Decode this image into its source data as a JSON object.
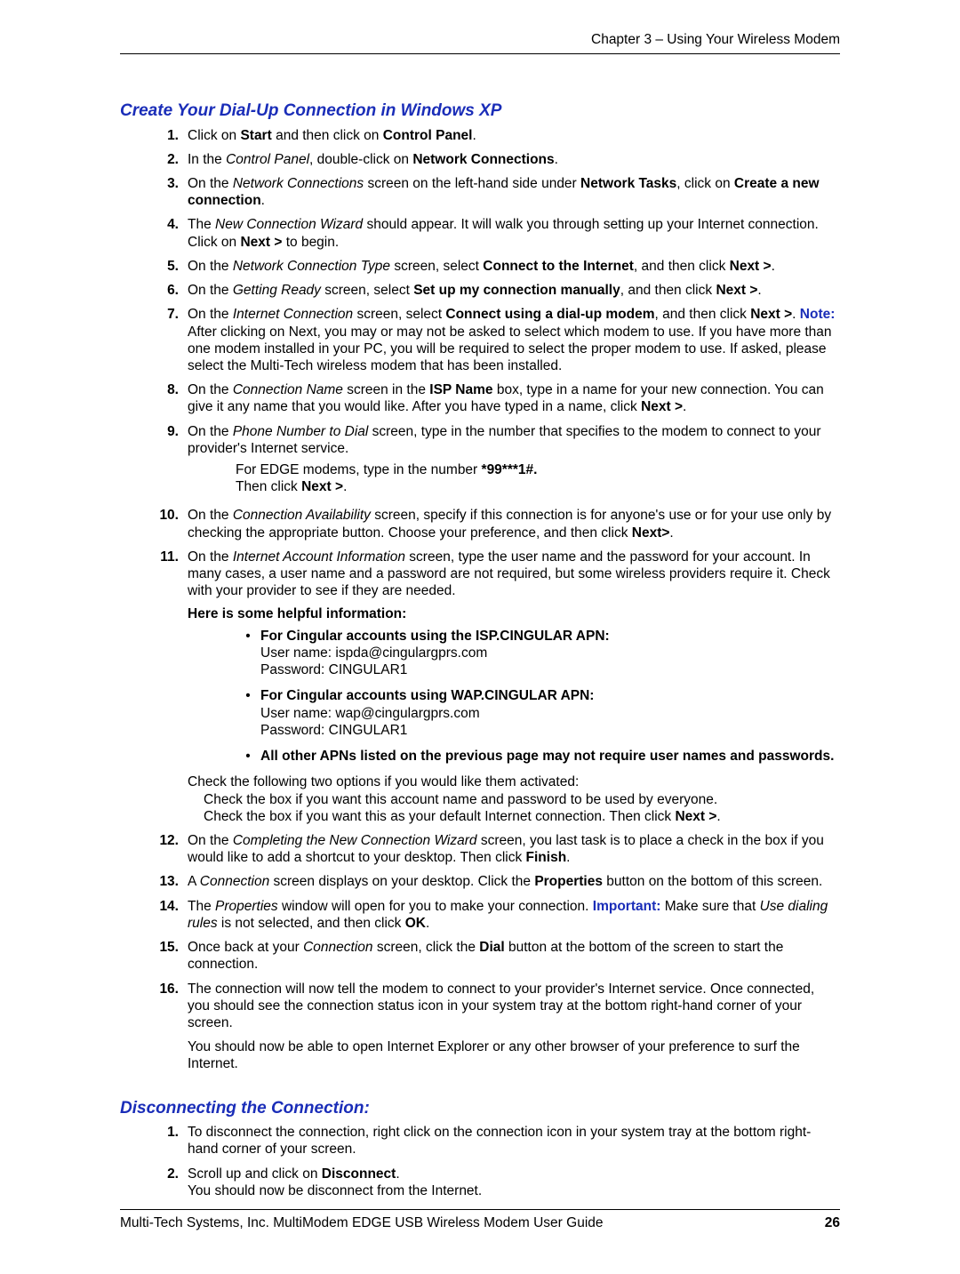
{
  "header": "Chapter 3 – Using Your Wireless Modem",
  "footer_left": "Multi-Tech Systems, Inc. MultiModem EDGE USB Wireless Modem User Guide",
  "footer_right": "26",
  "h1": "Create Your Dial-Up Connection in Windows XP",
  "h2": "Disconnecting the Connection:",
  "s1": {
    "n": "1.",
    "a": "Click on ",
    "b": "Start",
    "c": " and then click on ",
    "d": "Control Panel",
    "e": "."
  },
  "s2": {
    "n": "2.",
    "a": "In the ",
    "b": "Control Panel",
    "c": ", double-click on ",
    "d": "Network Connections",
    "e": "."
  },
  "s3": {
    "n": "3.",
    "a": "On the ",
    "b": "Network Connections",
    "c": " screen on the left-hand side under ",
    "d": "Network Tasks",
    "e": ", click on ",
    "f": "Create a new connection",
    "g": "."
  },
  "s4": {
    "n": "4.",
    "a": "The ",
    "b": "New Connection Wizard",
    "c": " should appear. It will walk you through setting up your Internet connection. Click on ",
    "d": "Next >",
    "e": " to begin."
  },
  "s5": {
    "n": "5.",
    "a": "On the ",
    "b": "Network Connection Type",
    "c": " screen, select ",
    "d": "Connect to the Internet",
    "e": ", and then click ",
    "f": "Next >",
    "g": "."
  },
  "s6": {
    "n": "6.",
    "a": "On the ",
    "b": "Getting Ready",
    "c": " screen, select ",
    "d": "Set up my connection manually",
    "e": ", and then click ",
    "f": "Next >",
    "g": "."
  },
  "s7": {
    "n": "7.",
    "a": "On the ",
    "b": "Internet Connection",
    "c": " screen, select ",
    "d": "Connect using a dial-up modem",
    "e": ", and then click ",
    "f": "Next >",
    "g": ". ",
    "note": "Note:",
    "h": " After clicking on Next, you may or may not be asked to select which modem to use. If you have more than one modem installed in your PC, you will be required to select the proper modem to use. If asked, please select the Multi-Tech wireless modem that has been installed."
  },
  "s8": {
    "n": "8.",
    "a": "On the ",
    "b": "Connection Name",
    "c": " screen in the ",
    "d": "ISP Name",
    "e": " box, type in a name for your new connection. You can give it any name that you would like. After you have typed in a name, click ",
    "f": "Next >",
    "g": "."
  },
  "s9": {
    "n": "9.",
    "a": "On the ",
    "b": "Phone Number to Dial",
    "c": " screen, type in the number that specifies to the modem to connect to your provider's Internet service.",
    "line1a": "For EDGE modems, type in the number ",
    "line1b": "*99***1#.",
    "line2a": "Then click ",
    "line2b": "Next >",
    "line2c": "."
  },
  "s10": {
    "n": "10.",
    "a": "On the ",
    "b": "Connection Availability",
    "c": " screen, specify if this connection is for anyone's use or for your use only by checking the appropriate button. Choose your preference, and then click ",
    "d": "Next>",
    "e": "."
  },
  "s11": {
    "n": "11.",
    "a": "On the ",
    "b": "Internet Account Information",
    "c": " screen, type the user name and the password for your account. In many cases, a user name and a password are not required, but some wireless providers require it. Check with your provider to see if they are needed.",
    "helpful": "Here is some helpful information:",
    "bul1_h": "For Cingular accounts using the ISP.CINGULAR APN:",
    "bul1_u": "User name: ispda@cingulargprs.com",
    "bul1_p": "Password: CINGULAR1",
    "bul2_h": "For Cingular accounts using WAP.CINGULAR APN:",
    "bul2_u": "User name: wap@cingulargprs.com",
    "bul2_p": "Password: CINGULAR1",
    "bul3": "All other APNs listed on the previous page may not require user names and passwords.",
    "check_intro": "Check the following two options if you would like them activated:",
    "check1": "Check the box if you want this account name and password to be used by everyone.",
    "check2a": "Check the box if you want this as your default Internet connection. Then click ",
    "check2b": "Next >",
    "check2c": "."
  },
  "s12": {
    "n": "12.",
    "a": "On the ",
    "b": "Completing the New Connection Wizard",
    "c": " screen, you last task is to place a check in the box if you would like to add a shortcut to your desktop. Then click ",
    "d": "Finish",
    "e": "."
  },
  "s13": {
    "n": "13.",
    "a": "A ",
    "b": "Connection",
    "c": " screen displays on your desktop. Click the ",
    "d": "Properties",
    "e": " button on the bottom of this screen."
  },
  "s14": {
    "n": "14.",
    "a": "The ",
    "b": "Properties",
    "c": " window will open for you to make your connection. ",
    "imp": "Important:",
    "d": " Make sure that ",
    "e": "Use dialing rules",
    "f": " is not selected, and then click ",
    "g": "OK",
    "h": "."
  },
  "s15": {
    "n": "15.",
    "a": "Once back at your ",
    "b": "Connection",
    "c": " screen, click the ",
    "d": "Dial",
    "e": " button at the bottom of the screen to start the connection."
  },
  "s16": {
    "n": "16.",
    "a": "The connection will now tell the modem to connect to your provider's Internet service. Once connected, you should see the connection status icon in your system tray at the bottom right-hand corner of your screen.",
    "p2": "You should now be able to open Internet Explorer or any other browser of your preference to surf the Internet."
  },
  "d1": {
    "n": "1.",
    "a": "To disconnect the connection, right click on the connection icon in your system tray at the bottom right-hand corner of your screen."
  },
  "d2": {
    "n": "2.",
    "a": "Scroll up and click on ",
    "b": "Disconnect",
    "c": ".",
    "p2": "You should now be disconnect from the Internet."
  }
}
